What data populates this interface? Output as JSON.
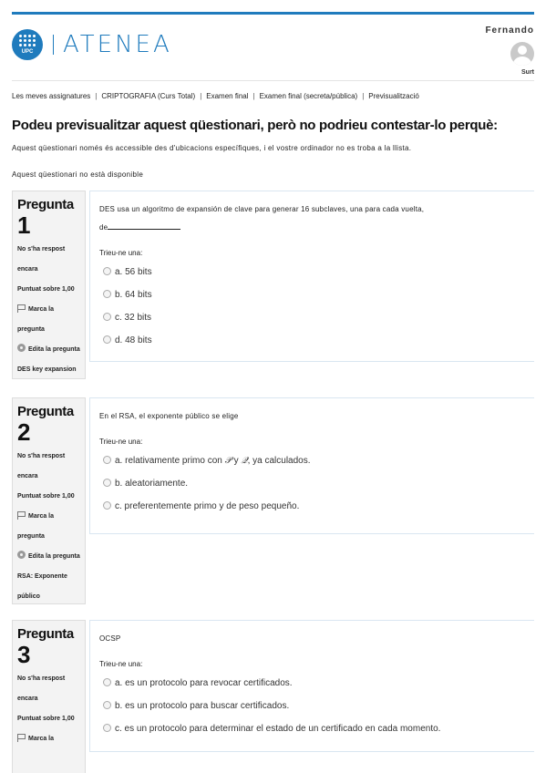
{
  "header": {
    "brand": "ATENEA",
    "logo_text": "UPC",
    "user_name": "Fernando",
    "logout_label": "Surt"
  },
  "breadcrumb": [
    "Les meves assignatures",
    "CRIPTOGRAFIA (Curs Total)",
    "Examen final",
    "Examen final (secreta/pública)",
    "Previsualització"
  ],
  "breadcrumb_separator": "|",
  "page": {
    "title": "Podeu previsualitzar aquest qüestionari, però no podrieu contestar-lo perquè:",
    "reason": "Aquest qüestionari només és accessible des d'ubicacions específiques, i el vostre ordinador no es troba a la llista.",
    "status": "Aquest qüestionari no està disponible"
  },
  "questions": [
    {
      "label": "Pregunta",
      "number": "1",
      "state": "No s'ha respost encara",
      "points": "Puntuat sobre 1,00",
      "flag_label": "Marca la pregunta",
      "edit_label": "Edita la pregunta DES key expansion",
      "text": "DES usa un algoritmo de expansión de clave para generar 16 subclaves, una para cada vuelta,",
      "text_suffix": "de",
      "prompt": "Trieu-ne una:",
      "options": [
        "a. 56 bits",
        "b. 64 bits",
        "c. 32 bits",
        "d. 48 bits"
      ]
    },
    {
      "label": "Pregunta",
      "number": "2",
      "state": "No s'ha respost encara",
      "points": "Puntuat sobre 1,00",
      "flag_label": "Marca la pregunta",
      "edit_label": "Edita la pregunta RSA: Exponente público",
      "text": "En el RSA, el exponente público se elige",
      "prompt": "Trieu-ne una:",
      "options": [
        "a. relativamente primo con",
        "b. aleatoriamente.",
        "c. preferentemente primo y de peso pequeño."
      ],
      "option_a_math_p": "𝒫",
      "option_a_and": " y ",
      "option_a_math_q": "𝒬",
      "option_a_tail": ", ya calculados."
    },
    {
      "label": "Pregunta",
      "number": "3",
      "state": "No s'ha respost encara",
      "points": "Puntuat sobre 1,00",
      "flag_label": "Marca la",
      "text": "OCSP",
      "prompt": "Trieu-ne una:",
      "options": [
        "a. es un protocolo para revocar certificados.",
        "b. es un protocolo para buscar certificados.",
        "c. es un protocolo para determinar el estado de un certificado en cada momento."
      ]
    }
  ],
  "colors": {
    "accent": "#1f7bbd"
  }
}
